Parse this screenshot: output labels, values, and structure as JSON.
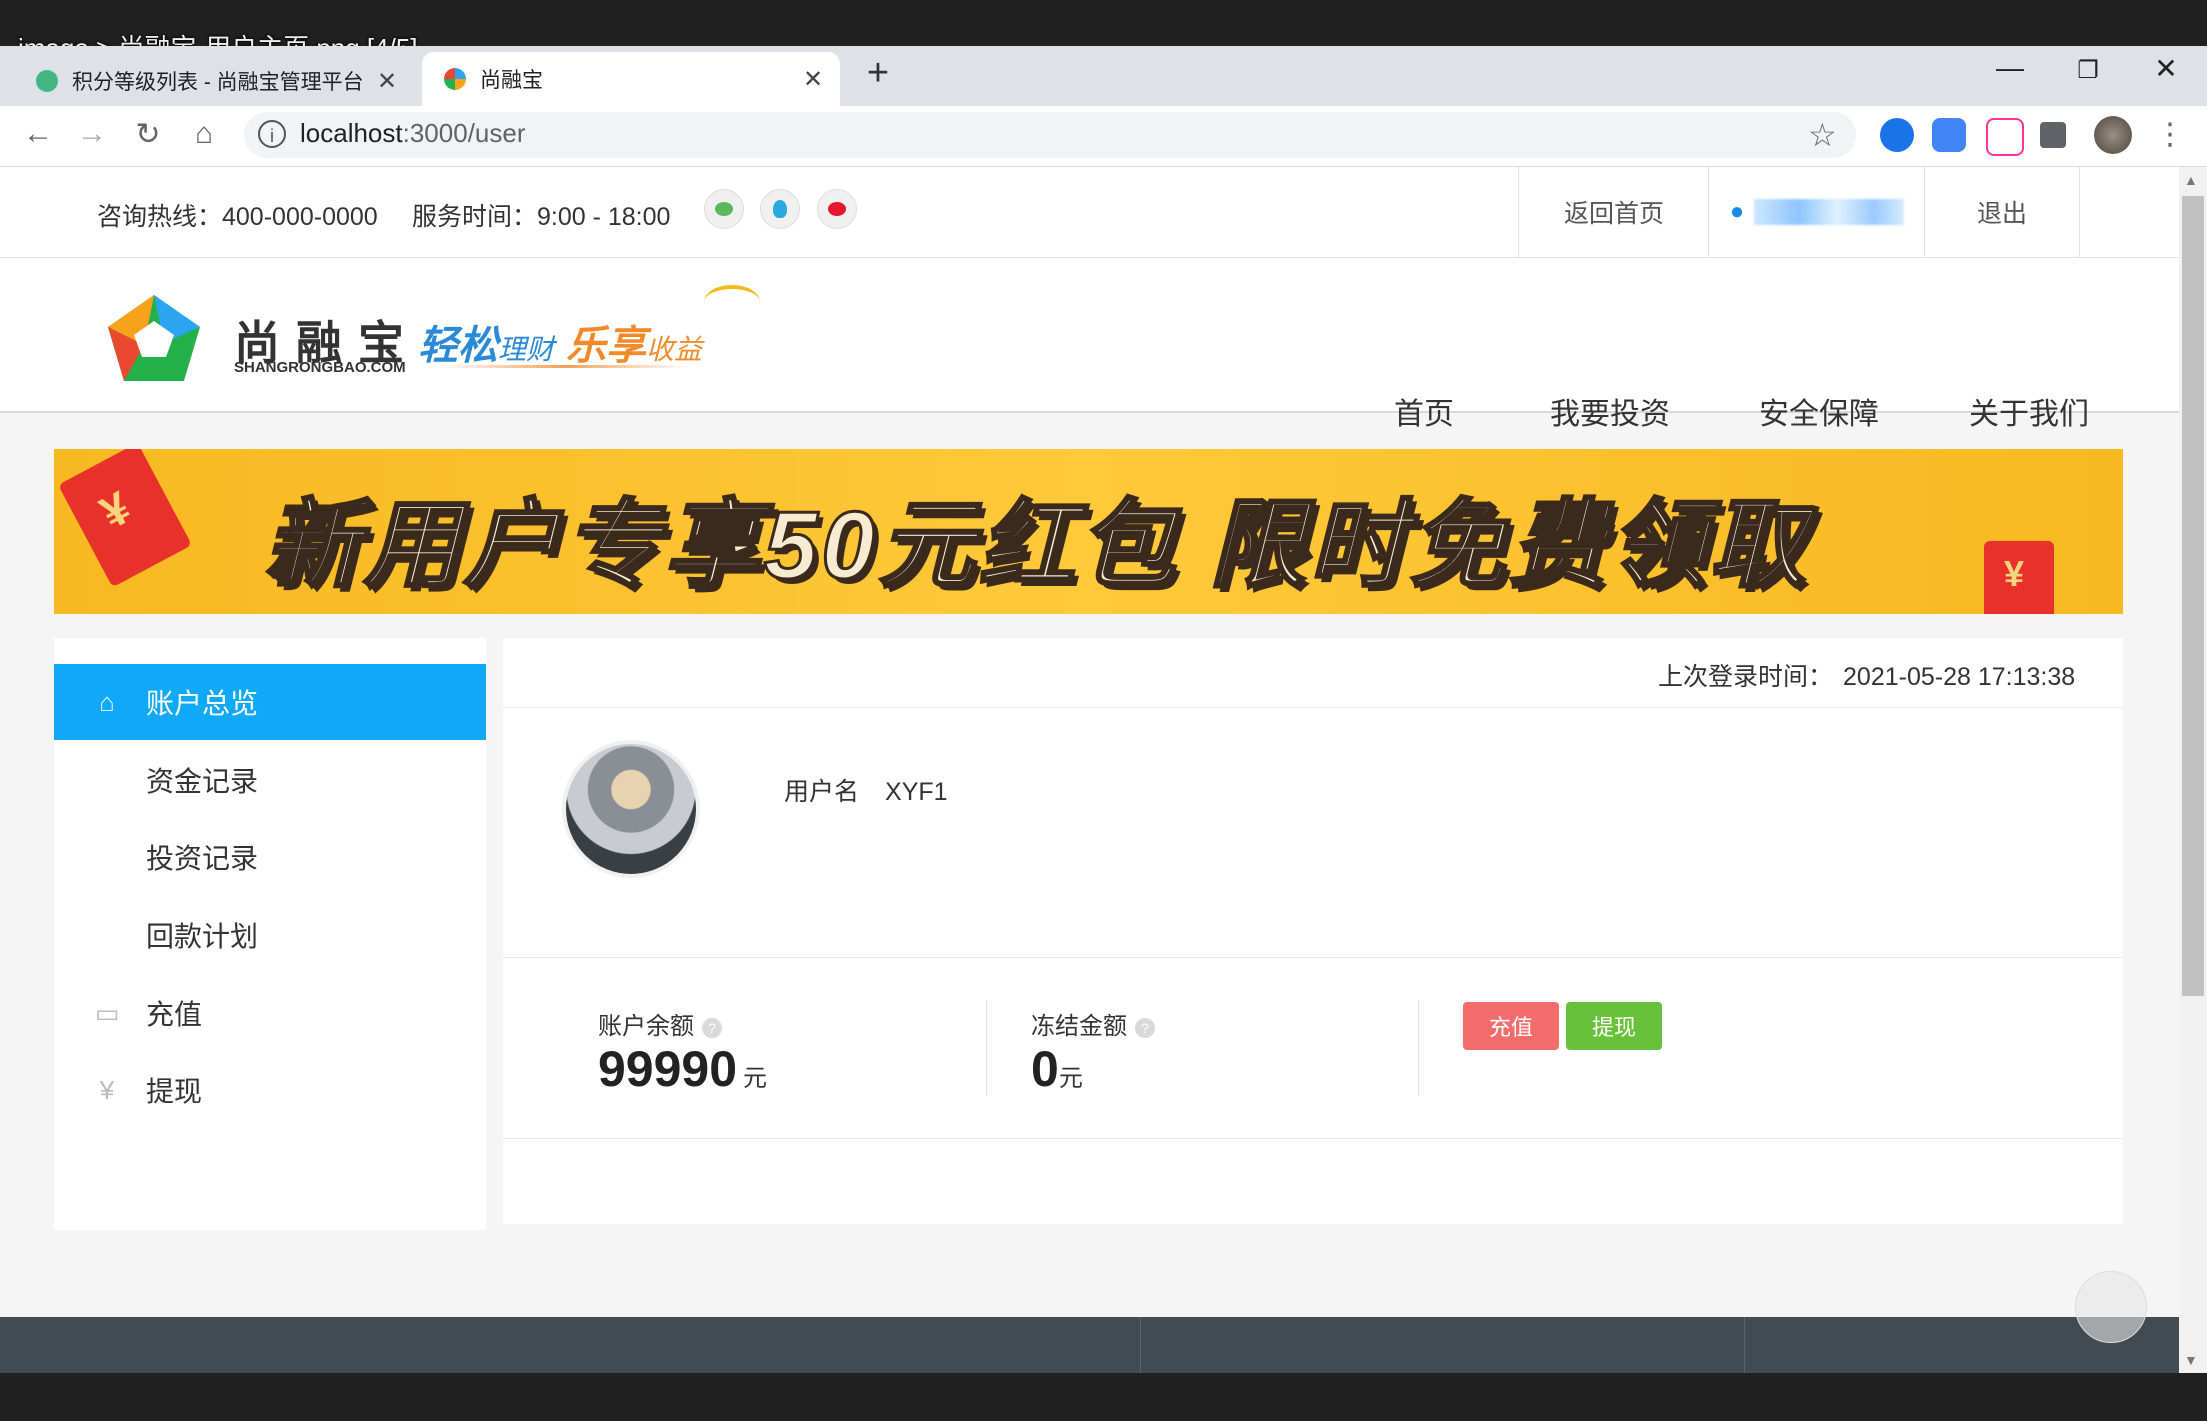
{
  "viewer": {
    "caption": "image > 尚融宝-用户主页.png [4/5]"
  },
  "browser": {
    "tabs": [
      {
        "title": "积分等级列表 - 尚融宝管理平台",
        "active": false
      },
      {
        "title": "尚融宝",
        "active": true
      }
    ],
    "url_host": "localhost",
    "url_path": ":3000/user",
    "new_tab_symbol": "+",
    "close_symbol": "✕"
  },
  "header": {
    "hotline": "咨询热线：400-000-0000",
    "service_time": "服务时间：9:00 - 18:00",
    "social_icons": [
      "wechat-icon",
      "qq-icon",
      "weibo-icon"
    ],
    "back_home": "返回首页",
    "username_masked": "",
    "logout": "退出"
  },
  "brand": {
    "name": "尚 融 宝",
    "domain": "SHANGRONGBAO.COM",
    "slogan_a": "轻松",
    "slogan_b": "理财",
    "slogan_c": "乐享",
    "slogan_d": "收益"
  },
  "nav": {
    "items": [
      "首页",
      "我要投资",
      "安全保障",
      "关于我们"
    ]
  },
  "banner": {
    "text": "新用户专享50元红包 限时免费领取"
  },
  "sidebar": {
    "items": [
      {
        "label": "账户总览",
        "icon": "home-icon",
        "active": true
      },
      {
        "label": "资金记录",
        "icon": "",
        "active": false
      },
      {
        "label": "投资记录",
        "icon": "",
        "active": false
      },
      {
        "label": "回款计划",
        "icon": "",
        "active": false
      },
      {
        "label": "充值",
        "icon": "folder-icon",
        "active": false
      },
      {
        "label": "提现",
        "icon": "yen-icon",
        "active": false
      }
    ]
  },
  "account": {
    "last_login_label": "上次登录时间：",
    "last_login_time": "2021-05-28 17:13:38",
    "username_label": "用户名",
    "username": "XYF1",
    "balance_label": "账户余额",
    "balance": "99990",
    "balance_unit": "元",
    "frozen_label": "冻结金额",
    "frozen": "0",
    "frozen_unit": "元",
    "recharge_button": "充值",
    "withdraw_button": "提现"
  },
  "colors": {
    "accent_blue": "#0fa9f7",
    "recharge_red": "#f56c6c",
    "withdraw_green": "#67c23a",
    "footer": "#424a52"
  }
}
